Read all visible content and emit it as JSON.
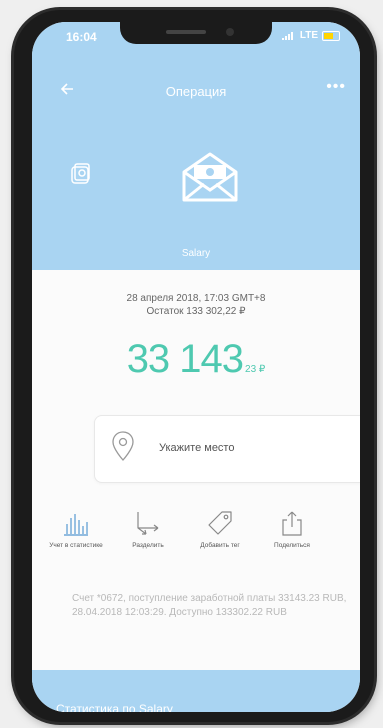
{
  "status_bar": {
    "time": "16:04",
    "network": "LTE"
  },
  "header": {
    "title": "Операция"
  },
  "category": {
    "name": "Salary"
  },
  "operation": {
    "date": "28 апреля 2018, 17:03 GMT+8",
    "balance": "Остаток 133 302,22 ₽",
    "amount_main": "33 143",
    "amount_fraction": "23 ₽"
  },
  "place": {
    "placeholder": "Укажите место"
  },
  "actions": [
    {
      "label": "Учет в статистике"
    },
    {
      "label": "Разделить"
    },
    {
      "label": "Добавить тег"
    },
    {
      "label": "Поделиться"
    }
  ],
  "description": "Счет *0672, поступление заработной платы 33143.23 RUB, 28.04.2018 12:03:29. Доступно 133302.22 RUB",
  "stats": {
    "label": "Статистика по Salary"
  },
  "colors": {
    "header_bg": "#a9d4f2",
    "amount": "#4ec9b0"
  }
}
